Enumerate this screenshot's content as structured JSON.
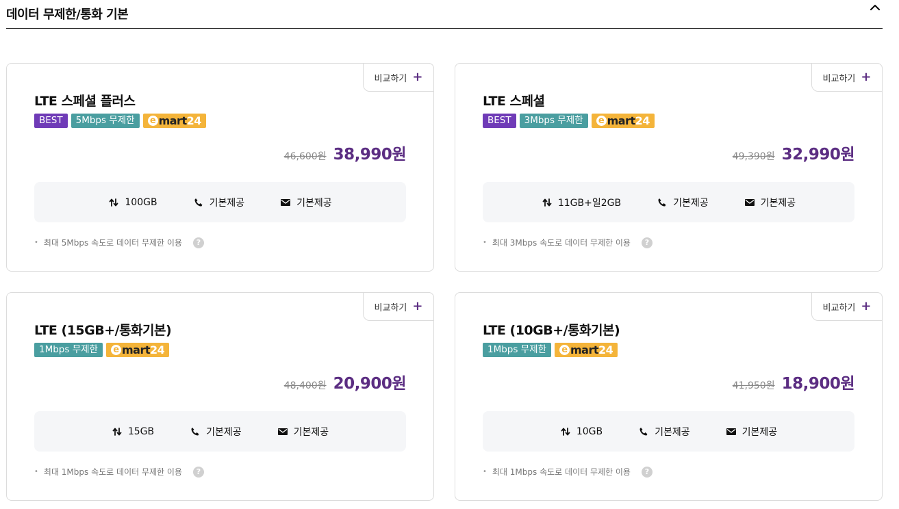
{
  "section": {
    "title": "데이터 무제한/통화 기본"
  },
  "plans": [
    {
      "name": "LTE 스페셜 플러스",
      "compare_label": "비교하기",
      "badges": {
        "best": "BEST",
        "speed": "5Mbps 무제한",
        "emart_e": "e",
        "emart_mart": "mart",
        "emart_24": "24"
      },
      "original_price": "46,600원",
      "sale_price": "38,990원",
      "specs": {
        "data": "100GB",
        "call": "기본제공",
        "sms": "기본제공"
      },
      "note": "최대 5Mbps 속도로 데이터 무제한 이용"
    },
    {
      "name": "LTE 스페셜",
      "compare_label": "비교하기",
      "badges": {
        "best": "BEST",
        "speed": "3Mbps 무제한",
        "emart_e": "e",
        "emart_mart": "mart",
        "emart_24": "24"
      },
      "original_price": "49,390원",
      "sale_price": "32,990원",
      "specs": {
        "data": "11GB+일2GB",
        "call": "기본제공",
        "sms": "기본제공"
      },
      "note": "최대 3Mbps 속도로 데이터 무제한 이용"
    },
    {
      "name": "LTE (15GB+/통화기본)",
      "compare_label": "비교하기",
      "badges": {
        "speed": "1Mbps 무제한",
        "emart_e": "e",
        "emart_mart": "mart",
        "emart_24": "24"
      },
      "original_price": "48,400원",
      "sale_price": "20,900원",
      "specs": {
        "data": "15GB",
        "call": "기본제공",
        "sms": "기본제공"
      },
      "note": "최대 1Mbps 속도로 데이터 무제한 이용"
    },
    {
      "name": "LTE (10GB+/통화기본)",
      "compare_label": "비교하기",
      "badges": {
        "speed": "1Mbps 무제한",
        "emart_e": "e",
        "emart_mart": "mart",
        "emart_24": "24"
      },
      "original_price": "41,950원",
      "sale_price": "18,900원",
      "specs": {
        "data": "10GB",
        "call": "기본제공",
        "sms": "기본제공"
      },
      "note": "최대 1Mbps 속도로 데이터 무제한 이용"
    }
  ],
  "icons": {
    "collapse": "chevron-up-icon",
    "compare": "plus-icon",
    "data": "data-transfer-icon",
    "call": "phone-icon",
    "sms": "mail-icon",
    "help": "question-circle-icon"
  },
  "colors": {
    "accent_purple": "#5b2d82",
    "best_badge": "#6f3bb7",
    "speed_badge": "#4a9ea0",
    "emart_badge": "#f4b43a"
  }
}
